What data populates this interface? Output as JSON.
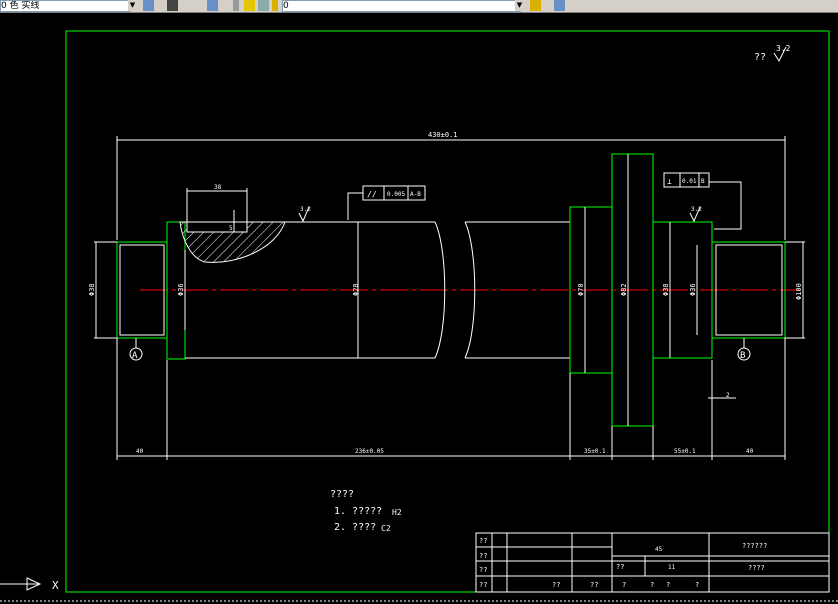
{
  "toolbar": {
    "layer_combo_value": "0 ⾊ 实线",
    "layer_name_value": "0"
  },
  "drawing": {
    "roughness_note": "??",
    "roughness_value": "3.2",
    "overall_length": "430±0.1",
    "len_left_journal": "40",
    "len_middle": "236±0.05",
    "len_flange": "35±0.1",
    "len_right_step": "55±0.1",
    "len_right_journal": "40",
    "keyway_len": "38",
    "keyway_depth": "5",
    "chamfer": "2",
    "dia_left_journal": "Φ38",
    "dia_left_step": "Φ36",
    "dia_body": "Φ28",
    "dia_flange_inner": "Φ70",
    "dia_flange_outer": "Φ82",
    "dia_right_step": "Φ38",
    "dia_right_step2": "Φ36",
    "dia_right_journal": "Φ100",
    "datum_a": "A",
    "datum_b": "B",
    "tol_symbol_1": "//",
    "tol_value_1": "0.005",
    "tol_datum_1": "A-B",
    "tol_symbol_2": "⊥",
    "tol_value_2": "0.01",
    "tol_datum_2": "B",
    "rough_left": "3.2",
    "rough_right": "3.2",
    "notes_title": "????",
    "note_1_text": "1. ?????",
    "note_1_code": "H2",
    "note_2_text": "2. ????",
    "note_2_code": "C2"
  },
  "title_block": {
    "rows_left": [
      "??",
      "??",
      "??",
      "??"
    ],
    "scale": "45",
    "title_code": "??????",
    "drawing_code": "????",
    "sheet_a": "??",
    "sheet_a_val": "11",
    "bottom_a": "??",
    "bottom_b": "??",
    "bottom_c": "?",
    "bottom_d": "?",
    "bottom_e": "?",
    "bottom_f": "?"
  },
  "ucs": {
    "x_label": "X"
  },
  "colors": {
    "frame": "#00ff00",
    "geometry": "#ffffff",
    "centerline": "#ff0000",
    "background": "#000000"
  }
}
